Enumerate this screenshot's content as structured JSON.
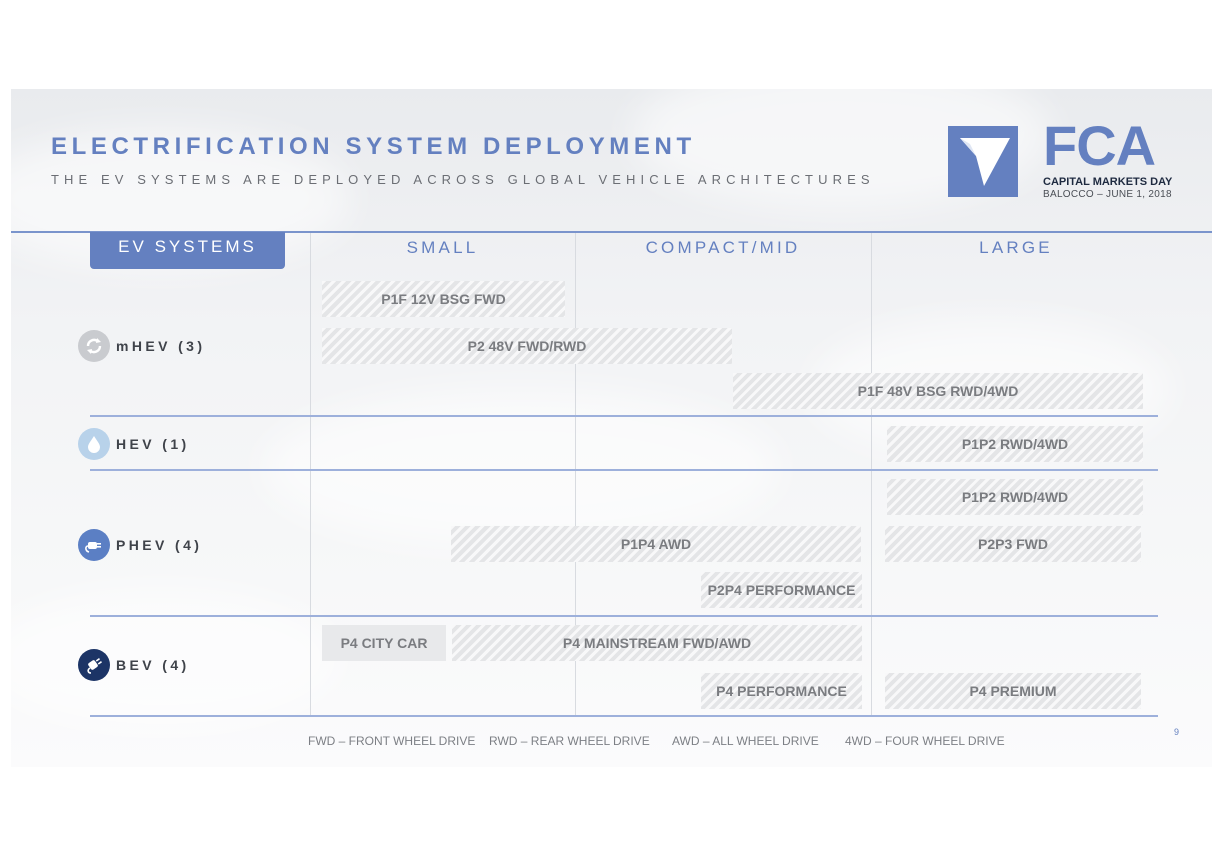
{
  "header": {
    "title": "ELECTRIFICATION SYSTEM DEPLOYMENT",
    "subtitle": "THE EV SYSTEMS ARE DEPLOYED ACROSS GLOBAL VEHICLE ARCHITECTURES"
  },
  "logo": {
    "wordmark": "FCA",
    "line1": "CAPITAL MARKETS DAY",
    "line2": "BALOCCO – JUNE 1, 2018",
    "color": "#6480c0"
  },
  "table": {
    "row_header_label": "EV SYSTEMS",
    "columns": [
      "SMALL",
      "COMPACT/MID",
      "LARGE"
    ],
    "rows": [
      {
        "label": "mHEV (3)",
        "icon": "recycle-arrows-icon",
        "icon_color": "#c9cbcf"
      },
      {
        "label": "HEV (1)",
        "icon": "water-drop-icon",
        "icon_color": "#b8d2ea"
      },
      {
        "label": "PHEV (4)",
        "icon": "plug-icon",
        "icon_color": "#5b7fc4"
      },
      {
        "label": "BEV (4)",
        "icon": "electric-plug-icon",
        "icon_color": "#1c3466"
      }
    ],
    "systems": {
      "mhev": [
        "P1F 12V BSG FWD",
        "P2 48V FWD/RWD",
        "P1F 48V BSG RWD/4WD"
      ],
      "hev": [
        "P1P2 RWD/4WD"
      ],
      "phev": [
        "P1P2 RWD/4WD",
        "P1P4 AWD",
        "P2P3 FWD",
        "P2P4 PERFORMANCE"
      ],
      "bev": [
        "P4 CITY CAR",
        "P4 MAINSTREAM FWD/AWD",
        "P4 PERFORMANCE",
        "P4 PREMIUM"
      ]
    }
  },
  "legend": {
    "fwd": "FWD – FRONT WHEEL DRIVE",
    "rwd": "RWD – REAR WHEEL DRIVE",
    "awd": "AWD – ALL WHEEL DRIVE",
    "4wd": "4WD – FOUR WHEEL DRIVE"
  },
  "page_number": "9",
  "colors": {
    "accent": "#6480c0",
    "rule": "#9db0db"
  }
}
